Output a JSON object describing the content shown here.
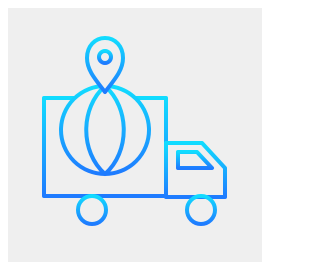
{
  "icon": {
    "name": "global-delivery-truck-icon",
    "parts": [
      "location-pin-icon",
      "globe-icon",
      "truck-icon"
    ]
  },
  "colors": {
    "page_background": "#ffffff",
    "tile_background": "#efefef",
    "gradient_top": "#11dcff",
    "gradient_bottom": "#1e7bff"
  }
}
